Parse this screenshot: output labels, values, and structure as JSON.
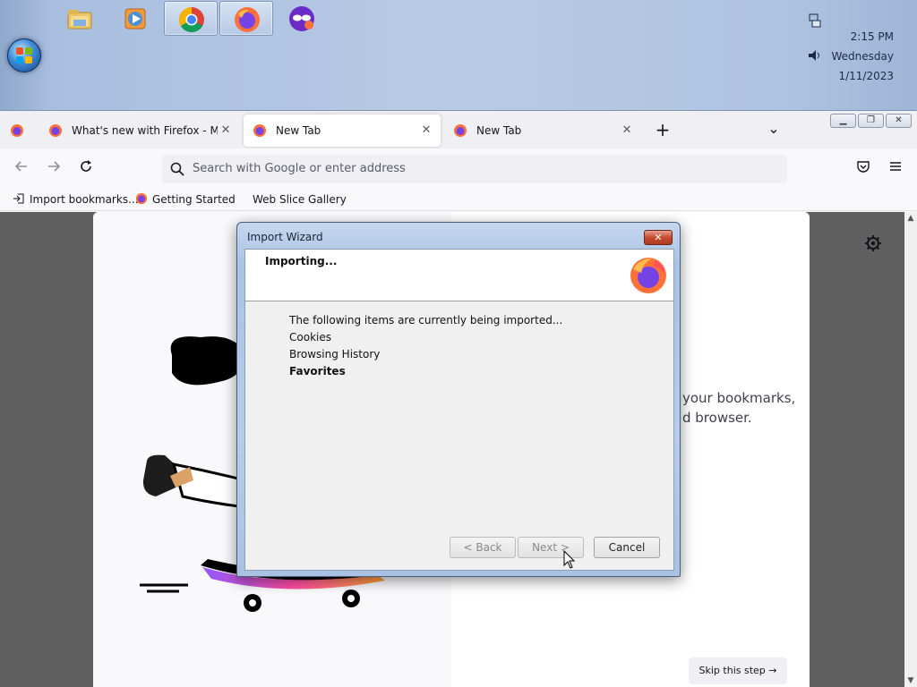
{
  "taskbar": {
    "pinned": [
      {
        "name": "file-explorer-icon"
      },
      {
        "name": "media-player-icon"
      },
      {
        "name": "chrome-icon"
      },
      {
        "name": "firefox-icon"
      },
      {
        "name": "private-browsing-icon"
      }
    ],
    "clock": {
      "time": "2:15 PM",
      "day": "Wednesday",
      "date": "1/11/2023"
    }
  },
  "browser": {
    "tabs": [
      {
        "label": "What's new with Firefox - More",
        "close": "✕"
      },
      {
        "label": "New Tab",
        "close": "✕"
      },
      {
        "label": "New Tab",
        "close": "✕"
      }
    ],
    "new_tab": "+",
    "list_all_tabs": "⌄",
    "url_placeholder": "Search with Google or enter address",
    "bookmarks": [
      {
        "label": "Import bookmarks..."
      },
      {
        "label": "Getting Started"
      },
      {
        "label": "Web Slice Gallery"
      }
    ]
  },
  "page": {
    "body_line1": "your bookmarks,",
    "body_line2": "d browser.",
    "skip_label": "Skip this step"
  },
  "dialog": {
    "title": "Import Wizard",
    "close": "✕",
    "heading": "Importing...",
    "intro": "The following items are currently being imported...",
    "items": [
      {
        "label": "Cookies",
        "state": "done"
      },
      {
        "label": "Browsing History",
        "state": "done"
      },
      {
        "label": "Favorites",
        "state": "in-progress"
      }
    ],
    "buttons": {
      "back": "< Back",
      "next": "Next >",
      "cancel": "Cancel"
    }
  },
  "colors": {
    "firefox_accent": "#ff7139",
    "firefox_purple": "#7542e5",
    "taskbar": "#b8cbe6"
  }
}
